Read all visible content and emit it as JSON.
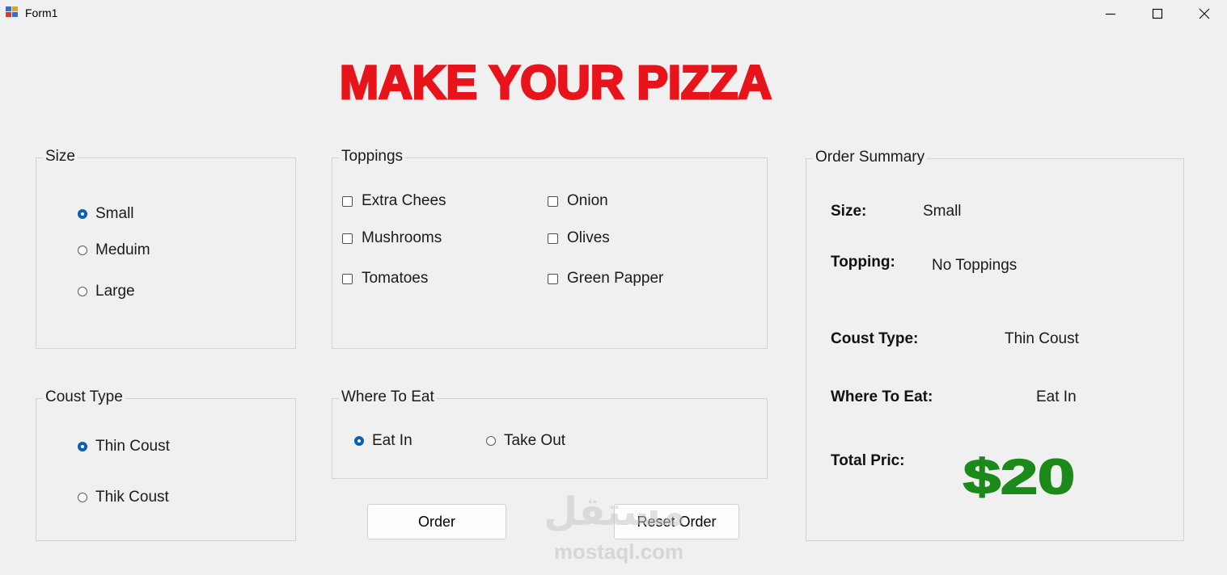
{
  "window": {
    "title": "Form1"
  },
  "banner": {
    "text": "MAKE YOUR PIZZA",
    "color": "#e8141b"
  },
  "size_group": {
    "label": "Size",
    "options": [
      {
        "label": "Small",
        "checked": true
      },
      {
        "label": "Meduim",
        "checked": false
      },
      {
        "label": "Large",
        "checked": false
      }
    ]
  },
  "toppings_group": {
    "label": "Toppings",
    "options": [
      {
        "label": "Extra Chees",
        "checked": false
      },
      {
        "label": "Onion",
        "checked": false
      },
      {
        "label": "Mushrooms",
        "checked": false
      },
      {
        "label": "Olives",
        "checked": false
      },
      {
        "label": "Tomatoes",
        "checked": false
      },
      {
        "label": "Green Papper",
        "checked": false
      }
    ]
  },
  "crust_group": {
    "label": "Coust Type",
    "options": [
      {
        "label": "Thin Coust",
        "checked": true
      },
      {
        "label": "Thik Coust",
        "checked": false
      }
    ]
  },
  "where_group": {
    "label": "Where To Eat",
    "options": [
      {
        "label": "Eat In",
        "checked": true
      },
      {
        "label": "Take Out",
        "checked": false
      }
    ]
  },
  "buttons": {
    "order": "Order",
    "reset": "Reset  Order"
  },
  "summary": {
    "label": "Order Summary",
    "size_label": "Size:",
    "size_value": "Small",
    "topping_label": "Topping:",
    "topping_value": "No Toppings",
    "crust_label": "Coust Type:",
    "crust_value": "Thin Coust",
    "where_label": "Where To Eat:",
    "where_value": "Eat In",
    "total_label": "Total Pric:",
    "total_value": "$20",
    "total_color": "#1b8a1b"
  },
  "watermark": {
    "arabic": "مستقل",
    "latin": "mostaql.com"
  },
  "colors": {
    "accent": "#0a5fb4",
    "background": "#f0f0f0"
  }
}
